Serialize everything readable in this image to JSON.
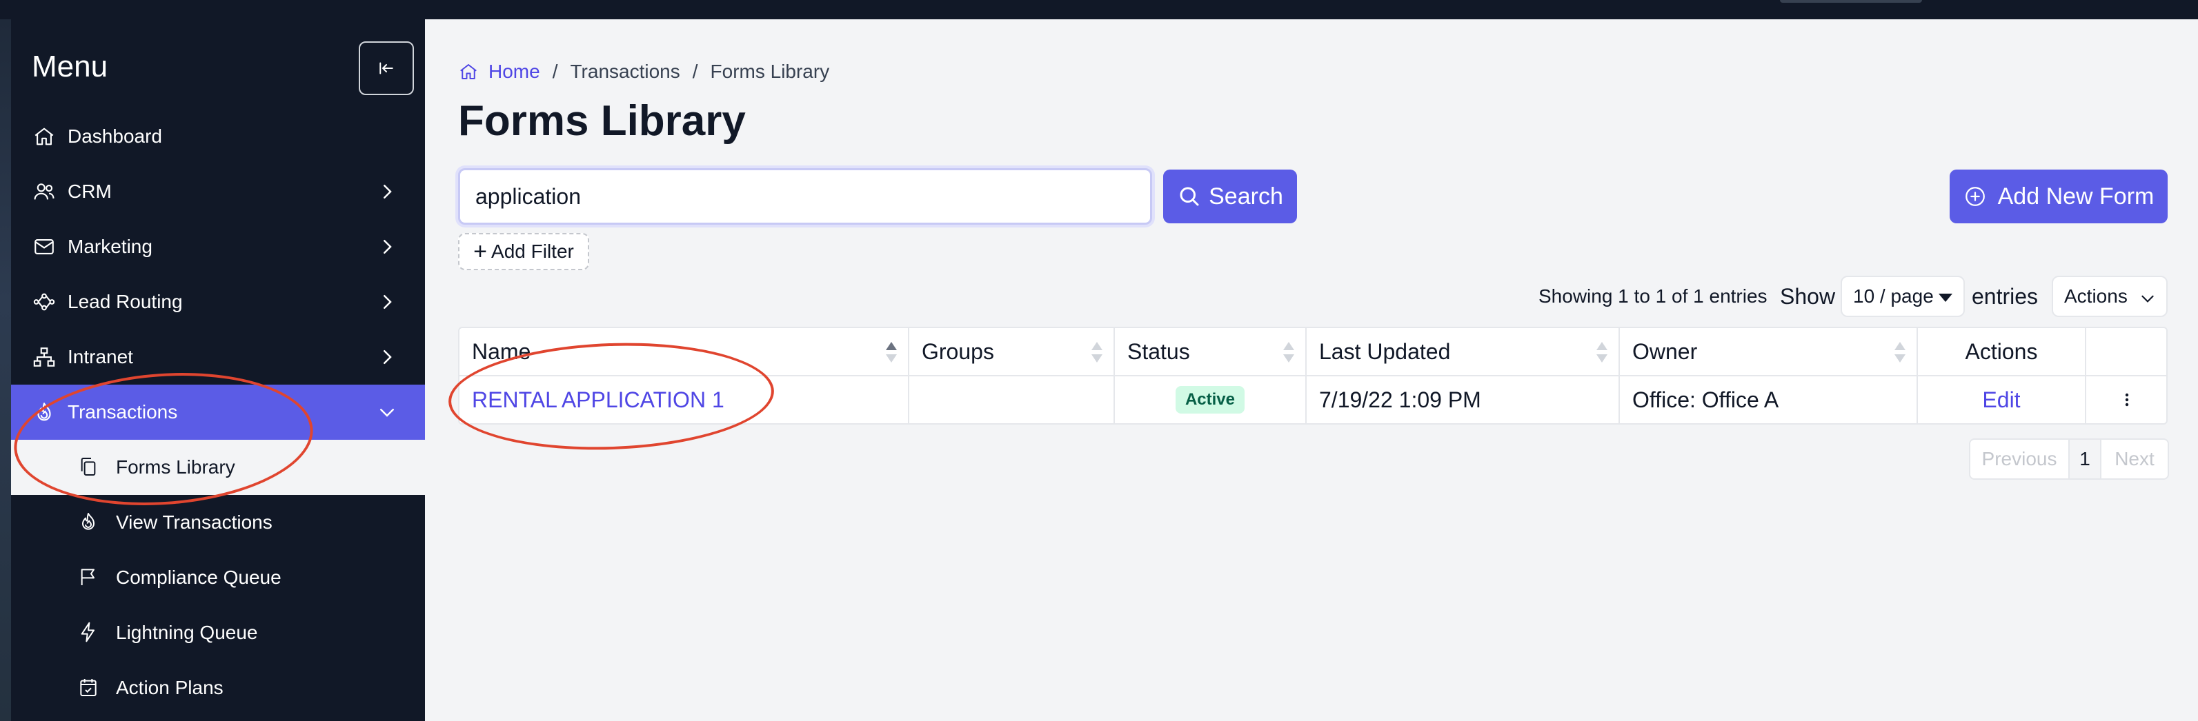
{
  "sidebar": {
    "title": "Menu",
    "items": [
      {
        "label": "Dashboard",
        "icon": "home-icon"
      },
      {
        "label": "CRM",
        "icon": "users-icon"
      },
      {
        "label": "Marketing",
        "icon": "mail-icon"
      },
      {
        "label": "Lead Routing",
        "icon": "share-icon"
      },
      {
        "label": "Intranet",
        "icon": "sitemap-icon"
      },
      {
        "label": "Transactions",
        "icon": "flame-icon"
      }
    ],
    "sub_items": [
      {
        "label": "Forms Library",
        "icon": "copy-icon"
      },
      {
        "label": "View Transactions",
        "icon": "flame-icon"
      },
      {
        "label": "Compliance Queue",
        "icon": "flag-icon"
      },
      {
        "label": "Lightning Queue",
        "icon": "bolt-icon"
      },
      {
        "label": "Action Plans",
        "icon": "calendar-check-icon"
      }
    ]
  },
  "breadcrumb": {
    "home": "Home",
    "sep": "/",
    "items": [
      "Transactions",
      "Forms Library"
    ]
  },
  "page": {
    "title": "Forms Library"
  },
  "search": {
    "value": "application",
    "button": "Search"
  },
  "toolbar": {
    "add_new_form": "Add New Form",
    "add_filter": "Add Filter"
  },
  "table_controls": {
    "showing": "Showing 1 to 1 of 1 entries",
    "show": "Show",
    "per_page": "10 / page",
    "entries": "entries",
    "actions": "Actions"
  },
  "table": {
    "headers": [
      "Name",
      "Groups",
      "Status",
      "Last Updated",
      "Owner",
      "Actions"
    ],
    "rows": [
      {
        "name": "RENTAL APPLICATION 1",
        "groups": "",
        "status": "Active",
        "last_updated": "7/19/22 1:09 PM",
        "owner": "Office: Office A",
        "action": "Edit"
      }
    ]
  },
  "pagination": {
    "previous": "Previous",
    "current": "1",
    "next": "Next"
  },
  "colors": {
    "accent": "#5b5ce6",
    "sidebar_bg": "#111827",
    "link": "#4f46e5",
    "annotation": "#e0452f"
  }
}
